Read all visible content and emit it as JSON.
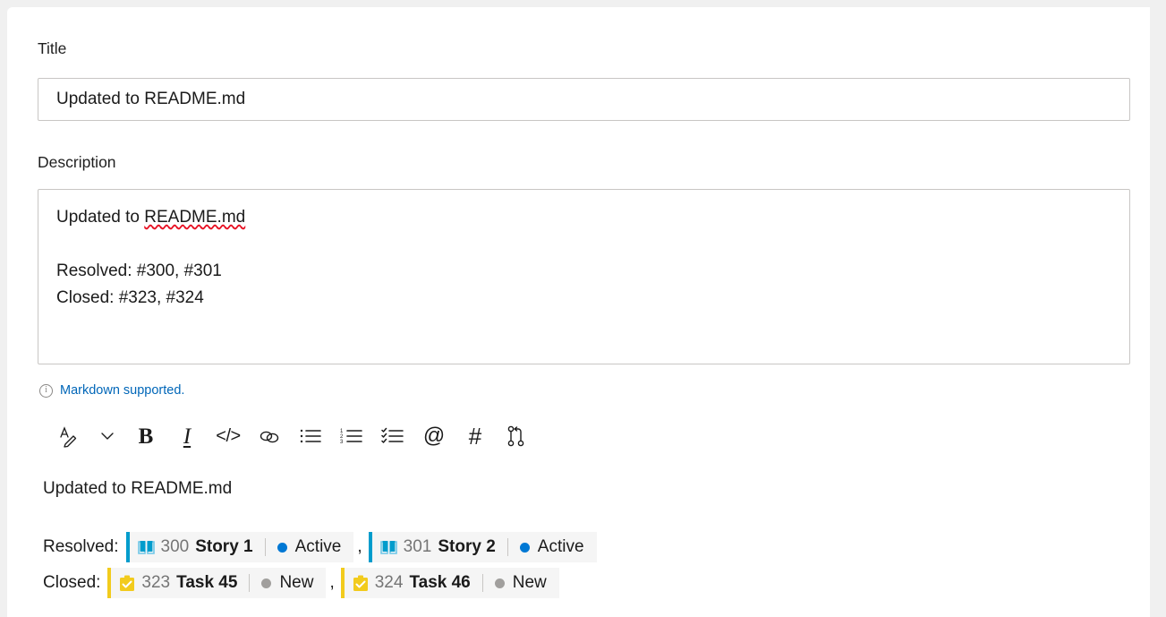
{
  "form": {
    "title_label": "Title",
    "title_value": "Updated to README.md",
    "description_label": "Description",
    "description_lines": [
      "Updated to README.md",
      "",
      "Resolved: #300, #301",
      "Closed: #323, #324"
    ],
    "description_line1_plain": "Updated to ",
    "description_line1_spellchecked": "README.md",
    "description_line3": "Resolved: #300, #301",
    "description_line4": "Closed: #323, #324",
    "markdown_hint": "Markdown supported.",
    "info_icon_glyph": "i"
  },
  "toolbar": {
    "items": [
      {
        "name": "text-style-icon",
        "label": "Text style"
      },
      {
        "name": "chevron-down-icon",
        "label": "More text styles"
      },
      {
        "name": "bold-icon",
        "label": "B"
      },
      {
        "name": "italic-icon",
        "label": "I"
      },
      {
        "name": "code-icon",
        "label": "</>"
      },
      {
        "name": "link-icon",
        "label": "Link"
      },
      {
        "name": "bulleted-list-icon",
        "label": "Bulleted list"
      },
      {
        "name": "numbered-list-icon",
        "label": "Numbered list"
      },
      {
        "name": "checklist-icon",
        "label": "Checklist"
      },
      {
        "name": "mention-icon",
        "label": "@"
      },
      {
        "name": "hashtag-icon",
        "label": "#"
      },
      {
        "name": "pull-request-icon",
        "label": "Pull request"
      }
    ]
  },
  "preview": {
    "heading": "Updated to README.md",
    "rows": [
      {
        "prefix": "Resolved:",
        "separator": ",",
        "chips": [
          {
            "id": "300",
            "title": "Story 1",
            "state": "Active",
            "type_icon": "user-story-icon",
            "accent_color": "#009ccc",
            "state_dot_color": "#0078d4"
          },
          {
            "id": "301",
            "title": "Story 2",
            "state": "Active",
            "type_icon": "user-story-icon",
            "accent_color": "#009ccc",
            "state_dot_color": "#0078d4"
          }
        ]
      },
      {
        "prefix": "Closed:",
        "separator": ",",
        "chips": [
          {
            "id": "323",
            "title": "Task 45",
            "state": "New",
            "type_icon": "task-icon",
            "accent_color": "#f2cb1d",
            "state_dot_color": "#a19f9d"
          },
          {
            "id": "324",
            "title": "Task 46",
            "state": "New",
            "type_icon": "task-icon",
            "accent_color": "#f2cb1d",
            "state_dot_color": "#a19f9d"
          }
        ]
      }
    ]
  },
  "colors": {
    "link": "#0066b8",
    "border": "#c8c6c4",
    "chip_background": "#f5f5f5",
    "page_background": "#f0f0f0"
  }
}
